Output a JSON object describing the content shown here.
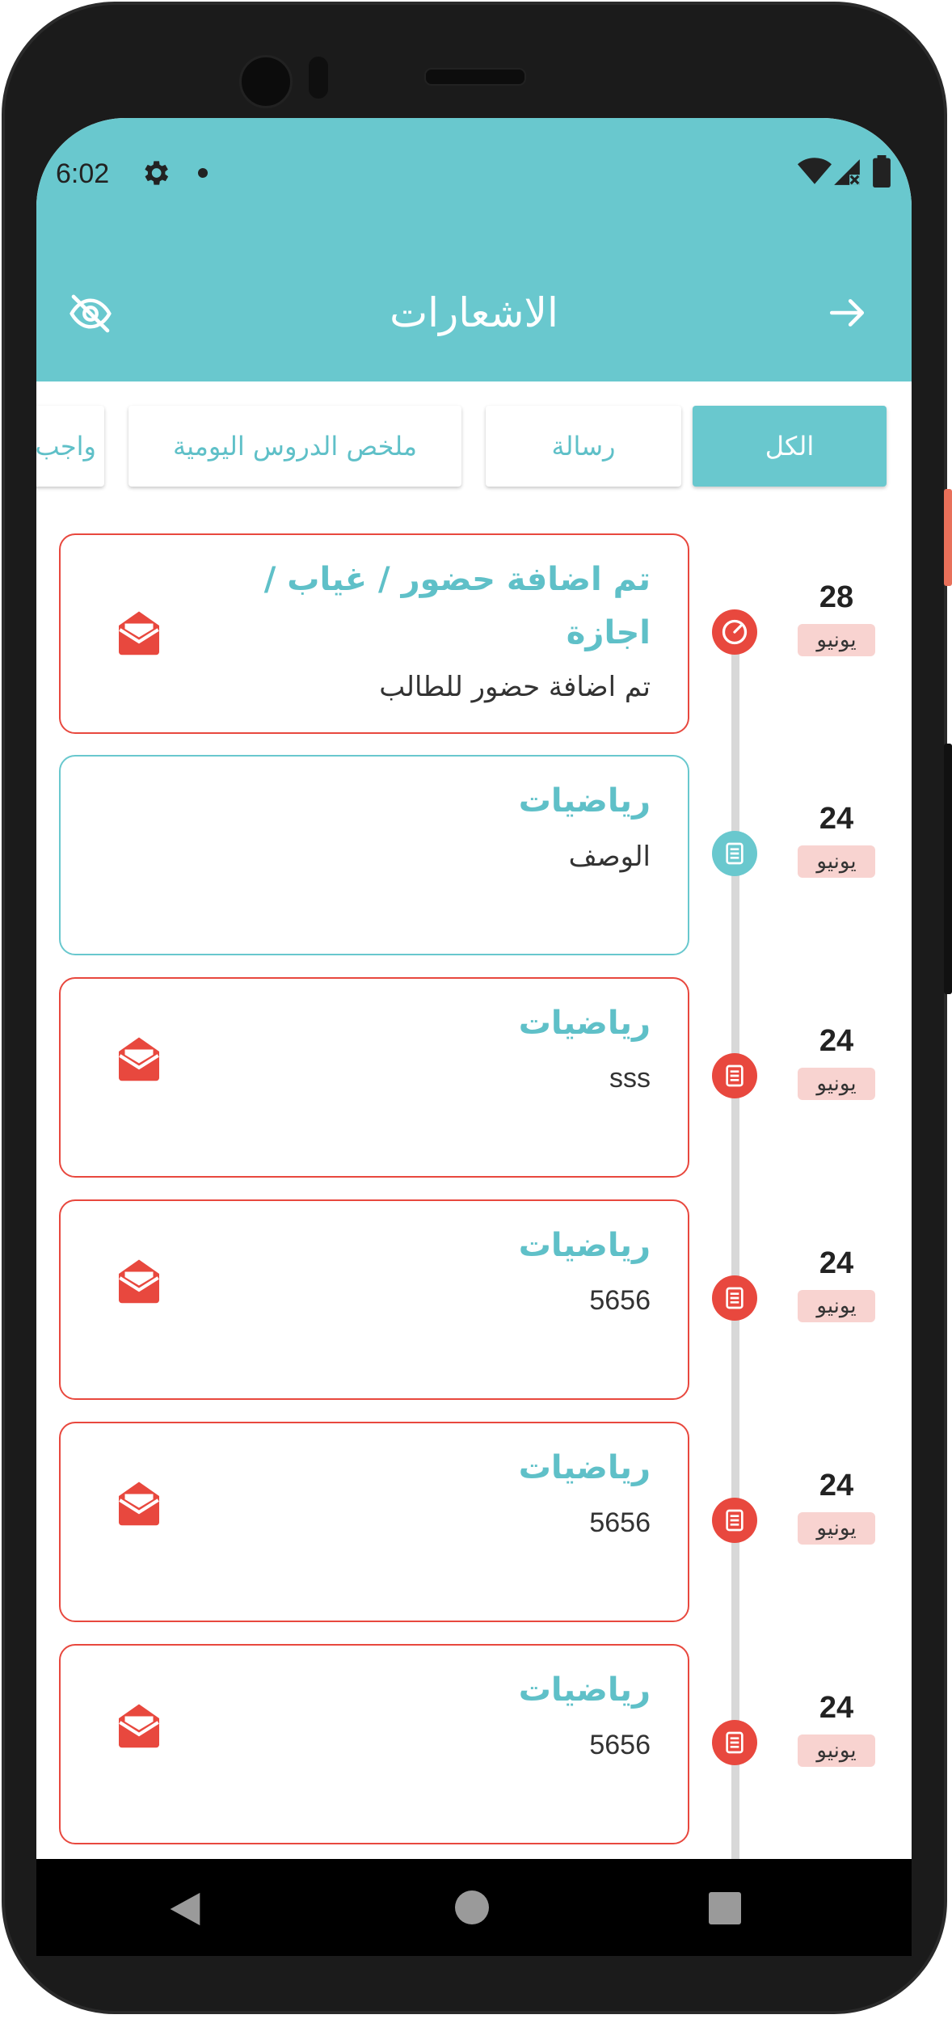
{
  "status_bar": {
    "time": "6:02"
  },
  "app_bar": {
    "title": "الاشعارات"
  },
  "tabs": [
    {
      "label": "الكل",
      "active": true
    },
    {
      "label": "رسالة",
      "active": false
    },
    {
      "label": "ملخص الدروس اليومية",
      "active": false
    },
    {
      "label": "واجب",
      "active": false
    }
  ],
  "notifications": [
    {
      "title": "تم اضافة حضور / غياب / اجازة",
      "description": "تم اضافة حضور للطالب",
      "day": "28",
      "month": "يونيو",
      "type": "attendance",
      "color": "#e8483e",
      "has_mail_icon": true
    },
    {
      "title": "رياضيات",
      "description": "الوصف",
      "day": "24",
      "month": "يونيو",
      "type": "lesson",
      "color": "#69c8ce",
      "has_mail_icon": false
    },
    {
      "title": "رياضيات",
      "description": "sss",
      "day": "24",
      "month": "يونيو",
      "type": "lesson",
      "color": "#e8483e",
      "has_mail_icon": true
    },
    {
      "title": "رياضيات",
      "description": "5656",
      "day": "24",
      "month": "يونيو",
      "type": "lesson",
      "color": "#e8483e",
      "has_mail_icon": true
    },
    {
      "title": "رياضيات",
      "description": "5656",
      "day": "24",
      "month": "يونيو",
      "type": "lesson",
      "color": "#e8483e",
      "has_mail_icon": true
    },
    {
      "title": "رياضيات",
      "description": "5656",
      "day": "24",
      "month": "يونيو",
      "type": "lesson",
      "color": "#e8483e",
      "has_mail_icon": true
    }
  ],
  "colors": {
    "primary": "#69c8ce",
    "alert": "#e8483e",
    "month_badge": "#f8d3d0"
  },
  "icons": {
    "back": "arrow-right-icon",
    "hide": "eye-off-icon",
    "mail": "open-envelope-icon",
    "attendance": "clock-icon",
    "lesson": "document-icon"
  }
}
